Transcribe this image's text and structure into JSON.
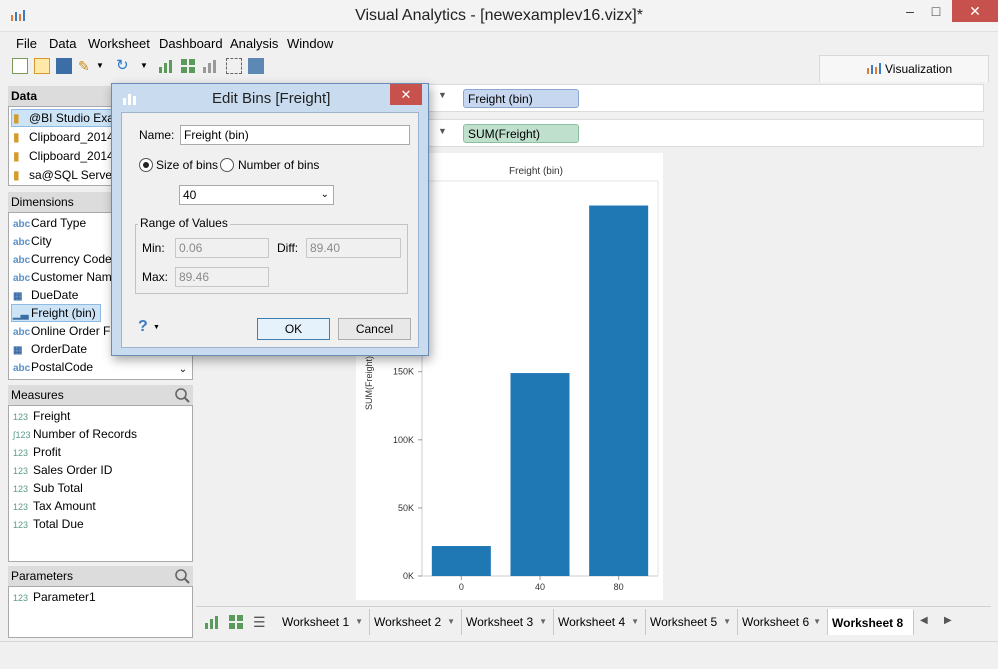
{
  "window": {
    "title": "Visual Analytics - [newexamplev16.vizx]*"
  },
  "menu": [
    "File",
    "Data",
    "Worksheet",
    "Dashboard",
    "Analysis",
    "Window"
  ],
  "viz_tab": {
    "label": "Visualization"
  },
  "data_panel": {
    "title": "Data",
    "items": [
      "@BI Studio Exa",
      "Clipboard_2014",
      "Clipboard_2014",
      "sa@SQL Server"
    ]
  },
  "dimensions": {
    "title": "Dimensions",
    "items": [
      {
        "icon": "abc",
        "label": "Card Type"
      },
      {
        "icon": "abc",
        "label": "City"
      },
      {
        "icon": "abc",
        "label": "Currency Code"
      },
      {
        "icon": "abc",
        "label": "Customer Name"
      },
      {
        "icon": "date",
        "label": "DueDate"
      },
      {
        "icon": "bin",
        "label": "Freight (bin)"
      },
      {
        "icon": "abc",
        "label": "Online Order Fla"
      },
      {
        "icon": "date",
        "label": "OrderDate"
      },
      {
        "icon": "abc",
        "label": "PostalCode"
      }
    ]
  },
  "measures": {
    "title": "Measures",
    "items": [
      "Freight",
      "Number of Records",
      "Profit",
      "Sales Order ID",
      "Sub Total",
      "Tax Amount",
      "Total Due"
    ]
  },
  "parameters": {
    "title": "Parameters",
    "items": [
      "Parameter1"
    ]
  },
  "shelves": {
    "columns_pill": "Freight (bin)",
    "rows_pill": "SUM(Freight)"
  },
  "colors": {
    "bar": "#1f77b4",
    "columns_pill": "#c7d7ef",
    "rows_pill": "#bfe0cd",
    "close": "#c7514c"
  },
  "dialog": {
    "title": "Edit Bins [Freight]",
    "name_label": "Name:",
    "name_value": "Freight (bin)",
    "size_of_bins": "Size of bins",
    "number_of_bins": "Number of bins",
    "bin_size": "40",
    "range_title": "Range of Values",
    "min_label": "Min:",
    "min_value": "0.06",
    "diff_label": "Diff:",
    "diff_value": "89.40",
    "max_label": "Max:",
    "max_value": "89.46",
    "ok": "OK",
    "cancel": "Cancel",
    "help": "?"
  },
  "chart_data": {
    "type": "bar",
    "title": "Freight (bin)",
    "ylabel": "SUM(Freight)",
    "categories": [
      "0",
      "40",
      "80"
    ],
    "values": [
      22000,
      149000,
      272000
    ],
    "ylim": [
      0,
      290000
    ],
    "yticks": [
      0,
      50000,
      100000,
      150000
    ],
    "ytick_labels": [
      "0K",
      "50K",
      "100K",
      "150K"
    ]
  },
  "worksheet_tabs": [
    "Worksheet 1",
    "Worksheet 2",
    "Worksheet 3",
    "Worksheet 4",
    "Worksheet 5",
    "Worksheet 6",
    "Worksheet 8"
  ],
  "active_tab": "Worksheet 8"
}
